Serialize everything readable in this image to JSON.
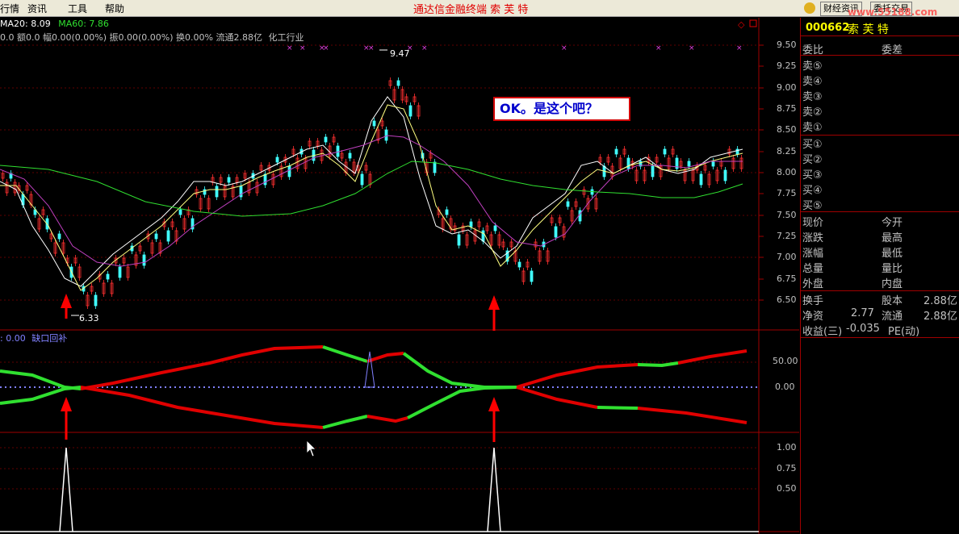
{
  "menu": {
    "items": [
      "行情",
      "资讯",
      "工具",
      "帮助"
    ]
  },
  "app_title": "通达信金融终端  索 芙 特",
  "top_buttons": {
    "news": "财经资讯",
    "trade": "委托交易"
  },
  "url": "www.55188.com",
  "info": {
    "ma20": "MA20: 8.09",
    "ma60": "MA60: 7.86",
    "line2": "0.0 额0.0 幅0.00(0.00%) 振0.00(0.00%) 换0.00% 流通2.88亿",
    "industry": "化工行业"
  },
  "indicator_label": {
    "value": ": 0.00",
    "name": "缺口回补"
  },
  "callout": "OK。是这个吧？",
  "annotations": {
    "high": "9.47",
    "low": "6.33"
  },
  "price_axis": [
    "9.50",
    "9.25",
    "9.00",
    "8.75",
    "8.50",
    "8.25",
    "8.00",
    "7.75",
    "7.50",
    "7.25",
    "7.00",
    "6.75",
    "6.50"
  ],
  "ind_axis": [
    "50.00",
    "0.00"
  ],
  "sub_axis": [
    "1.00",
    "0.75",
    "0.50"
  ],
  "panel": {
    "code": "000662",
    "name": "索 芙 特",
    "ratio": "委比",
    "diff": "委差",
    "sell": [
      "卖⑤",
      "卖④",
      "卖③",
      "卖②",
      "卖①"
    ],
    "buy": [
      "买①",
      "买②",
      "买③",
      "买④",
      "买⑤"
    ],
    "stats_left": [
      "现价",
      "涨跌",
      "涨幅",
      "总量",
      "外盘"
    ],
    "stats_right": [
      "今开",
      "最高",
      "最低",
      "量比",
      "内盘"
    ],
    "turnover": "换手",
    "capital": "股本",
    "capital_val": "2.88亿",
    "nav": "净资",
    "nav_val": "2.77",
    "float": "流通",
    "float_val": "2.88亿",
    "eps": "收益(三)",
    "eps_val": "-0.035",
    "pe": "PE(动)"
  },
  "colors": {
    "up": "#ff3030",
    "down": "#40ffff",
    "green": "#30e030",
    "red": "#e00000",
    "grid": "#a00000"
  }
}
